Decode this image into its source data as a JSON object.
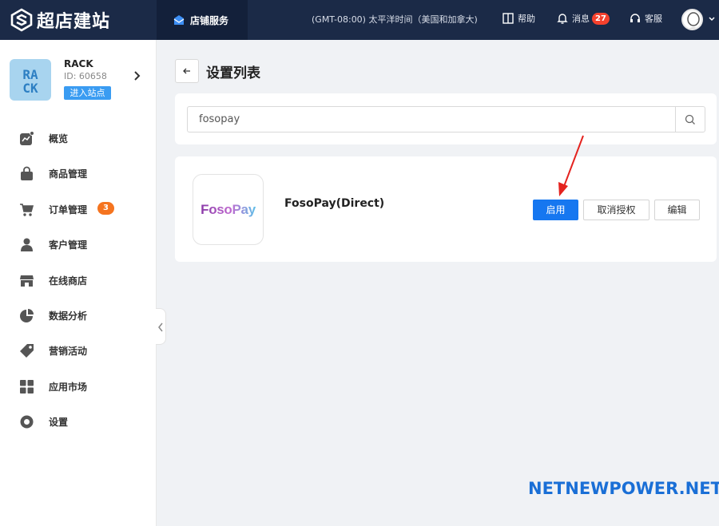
{
  "topbar": {
    "app_name": "超店建站",
    "active_tab": "店铺服务",
    "timezone": "(GMT-08:00) 太平洋时间（美国和加拿大)",
    "help": "帮助",
    "messages": "消息",
    "messages_count": "27",
    "support": "客服"
  },
  "store": {
    "logo_text": "RACK",
    "name": "RACK",
    "id": "ID: 60658",
    "enter_button": "进入站点"
  },
  "sidebar": {
    "items": [
      {
        "label": "概览",
        "icon": "chart-icon"
      },
      {
        "label": "商品管理",
        "icon": "bag-icon"
      },
      {
        "label": "订单管理",
        "icon": "cart-icon",
        "badge": "3"
      },
      {
        "label": "客户管理",
        "icon": "user-icon"
      },
      {
        "label": "在线商店",
        "icon": "store-icon"
      },
      {
        "label": "数据分析",
        "icon": "pie-icon"
      },
      {
        "label": "营销活动",
        "icon": "tag-icon"
      },
      {
        "label": "应用市场",
        "icon": "grid-icon"
      },
      {
        "label": "设置",
        "icon": "settings-icon"
      }
    ]
  },
  "main": {
    "title": "设置列表",
    "search_value": "fosopay",
    "result": {
      "logo_text": "FosoPay",
      "name": "FosoPay(Direct)",
      "enable_button": "启用",
      "revoke_button": "取消授权",
      "edit_button": "编辑"
    }
  },
  "watermark": "NETNEWPOWER.NET",
  "colors": {
    "topbar_bg": "#1b2a47",
    "primary": "#1677f0",
    "badge_red": "#f5412d",
    "badge_orange": "#f5741f",
    "annotation_arrow": "#e4231f"
  }
}
